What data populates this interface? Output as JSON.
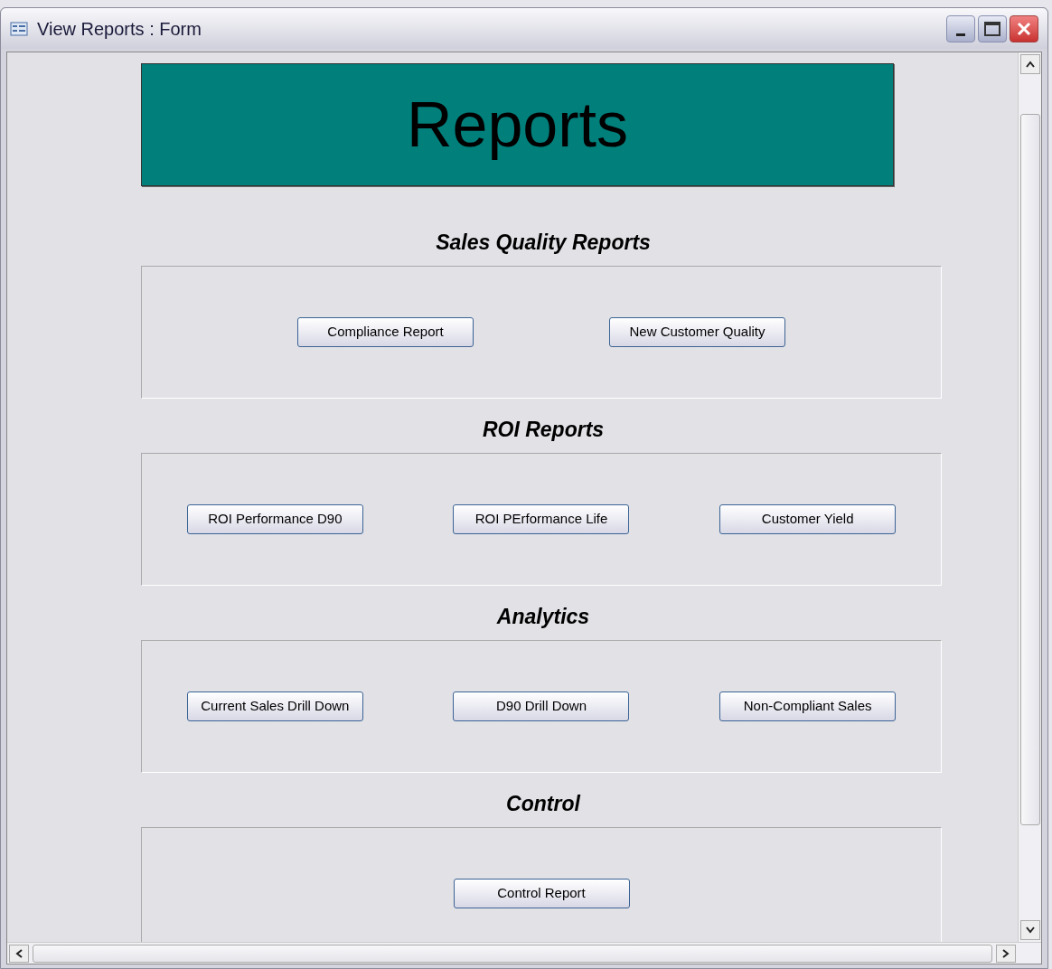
{
  "window": {
    "title": "View Reports : Form"
  },
  "banner": {
    "title": "Reports"
  },
  "sections": [
    {
      "heading": "Sales Quality Reports",
      "buttons": [
        "Compliance Report",
        "New Customer Quality"
      ]
    },
    {
      "heading": "ROI Reports",
      "buttons": [
        "ROI Performance D90",
        "ROI PErformance Life",
        "Customer Yield"
      ]
    },
    {
      "heading": "Analytics",
      "buttons": [
        "Current Sales Drill Down",
        "D90 Drill Down",
        "Non-Compliant Sales"
      ]
    },
    {
      "heading": "Control",
      "buttons": [
        "Control Report"
      ]
    }
  ]
}
